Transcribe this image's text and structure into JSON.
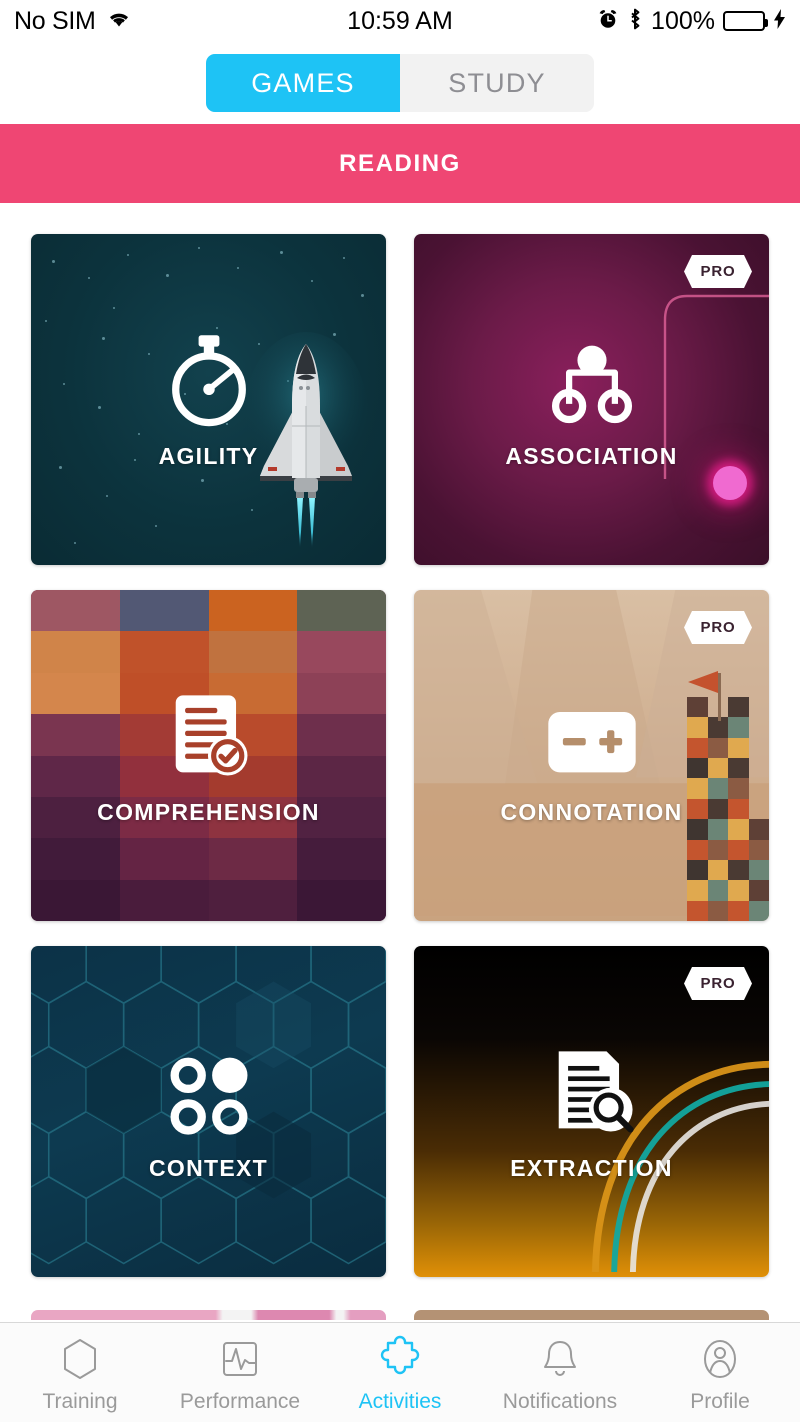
{
  "status_bar": {
    "carrier": "No SIM",
    "wifi_icon": "wifi-icon",
    "time": "10:59 AM",
    "alarm_icon": "alarm-clock-icon",
    "bluetooth_icon": "bluetooth-icon",
    "battery_percent": "100%",
    "battery_icon": "battery-full-icon",
    "charging_icon": "lightning-bolt-icon",
    "battery_fill_color": "#4CD964"
  },
  "segmented_control": {
    "tabs": [
      {
        "label": "GAMES",
        "active": true
      },
      {
        "label": "STUDY",
        "active": false
      }
    ],
    "active_color": "#1ec3f5",
    "inactive_text_color": "#8e8e93",
    "track_color": "#f2f2f2"
  },
  "category_banner": {
    "label": "READING",
    "color": "#ef4673"
  },
  "cards": [
    {
      "title": "AGILITY",
      "icon": "stopwatch-icon",
      "pro": false,
      "theme": "space-starfield-teal",
      "accent": "#12414d",
      "decoration": "space-shuttle"
    },
    {
      "title": "ASSOCIATION",
      "icon": "node-tree-icon",
      "pro": true,
      "pro_label": "PRO",
      "theme": "magenta-radial-glow",
      "accent": "#8a1f5c",
      "decoration": "glowing-circuit-trace"
    },
    {
      "title": "COMPREHENSION",
      "icon": "document-check-icon",
      "pro": false,
      "theme": "color-block-mosaic",
      "accent": "#b9492a",
      "decoration": "mosaic-grid"
    },
    {
      "title": "CONNOTATION",
      "icon": "minus-plus-card-icon",
      "pro": true,
      "pro_label": "PRO",
      "theme": "beige-desert-mountains",
      "accent": "#cfae8f",
      "decoration": "pixel-tower-with-flag"
    },
    {
      "title": "CONTEXT",
      "icon": "four-circles-icon",
      "pro": false,
      "theme": "dark-blue-hexagons",
      "accent": "#0d3a50",
      "decoration": "honeycomb-grid"
    },
    {
      "title": "EXTRACTION",
      "icon": "document-search-icon",
      "pro": true,
      "pro_label": "PRO",
      "theme": "black-amber-gradient",
      "accent": "#e09007",
      "decoration": "concentric-arcs"
    }
  ],
  "tab_bar": {
    "active_color": "#1ec3f5",
    "inactive_color": "#9a9a9a",
    "items": [
      {
        "label": "Training",
        "icon": "hexagon-icon",
        "active": false
      },
      {
        "label": "Performance",
        "icon": "pulse-chart-icon",
        "active": false
      },
      {
        "label": "Activities",
        "icon": "puzzle-piece-icon",
        "active": true
      },
      {
        "label": "Notifications",
        "icon": "bell-icon",
        "active": false
      },
      {
        "label": "Profile",
        "icon": "person-circle-icon",
        "active": false
      }
    ]
  }
}
